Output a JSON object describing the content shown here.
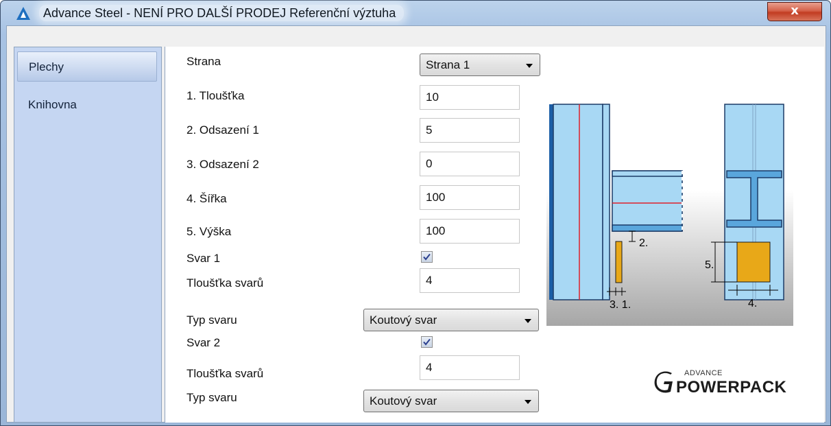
{
  "window": {
    "title": "Advance Steel - NENÍ PRO DALŠÍ PRODEJ   Referenční výztuha",
    "close_label": "x"
  },
  "sidebar": {
    "items": [
      {
        "label": "Plechy",
        "selected": true
      },
      {
        "label": "Knihovna",
        "selected": false
      }
    ]
  },
  "form": {
    "side_label": "Strana",
    "side_value": "Strana 1",
    "thickness_label": "1. Tloušťka",
    "thickness_value": "10",
    "offset1_label": "2. Odsazení 1",
    "offset1_value": "5",
    "offset2_label": "3. Odsazení 2",
    "offset2_value": "0",
    "width_label": "4. Šířka",
    "width_value": "100",
    "height_label": "5. Výška",
    "height_value": "100",
    "weld1_label": "Svar 1",
    "weld1_checked": true,
    "weld1_thickness_label": "Tloušťka svarů",
    "weld1_thickness_value": "4",
    "weld1_type_label": "Typ svaru",
    "weld1_type_value": "Koutový svar",
    "weld2_label": "Svar 2",
    "weld2_checked": true,
    "weld2_thickness_label": "Tloušťka svarů",
    "weld2_thickness_value": "4",
    "weld2_type_label": "Typ svaru",
    "weld2_type_value": "Koutový svar"
  },
  "diagram": {
    "label_offset1": "2.",
    "label_offset2_thickness": "3. 1.",
    "label_height": "5.",
    "label_width": "4."
  },
  "logo": {
    "small_text": "ADVANCE",
    "big_text": "POWERPACK"
  },
  "colors": {
    "steel": "#a8d8f4",
    "steel_dark": "#1b5ea6",
    "plate": "#e8a818",
    "red_line": "#e0202a"
  }
}
